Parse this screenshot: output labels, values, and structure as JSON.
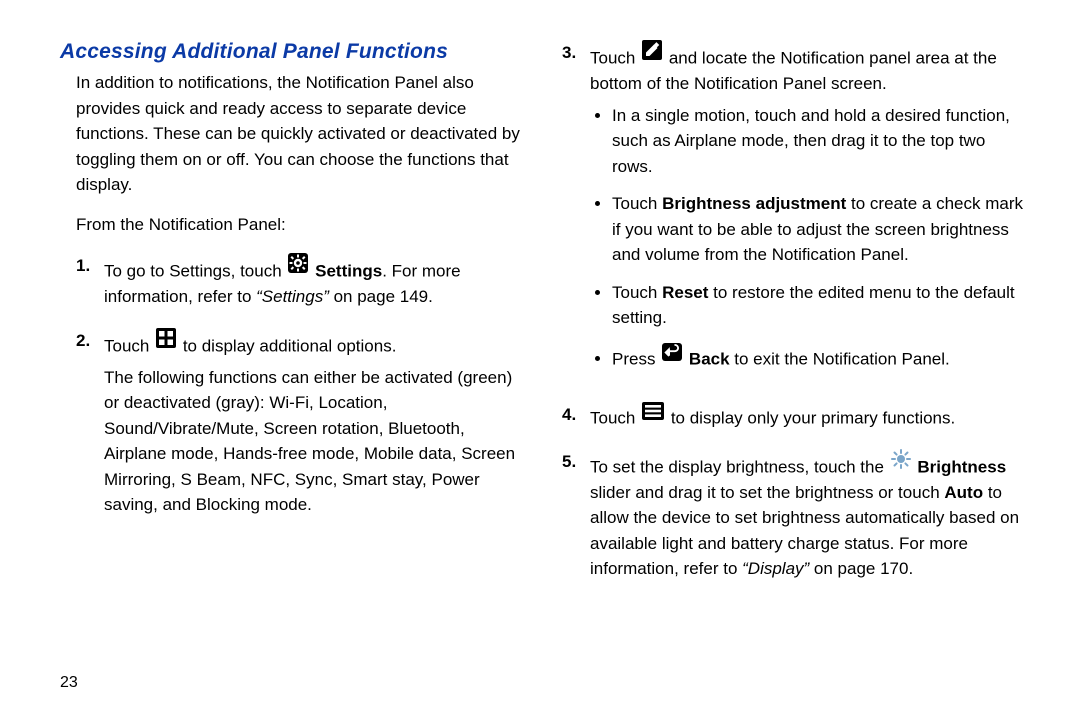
{
  "heading": "Accessing Additional Panel Functions",
  "intro": "In addition to notifications, the Notification Panel also provides quick and ready access to separate device functions. These can be quickly activated or deactivated by toggling them on or off. You can choose the functions that display.",
  "fromLine": "From the Notification Panel:",
  "step1": {
    "num": "1.",
    "t1": "To go to Settings, touch ",
    "iconLabel": "Settings",
    "t2": ". For more information, refer to ",
    "ref": "“Settings”",
    "t3": " on page 149."
  },
  "step2": {
    "num": "2.",
    "t1": "Touch ",
    "t2": " to display additional options.",
    "p2": "The following functions can either be activated (green) or deactivated (gray): Wi-Fi, Location, Sound/Vibrate/Mute, Screen rotation, Bluetooth, Airplane mode, Hands-free mode, Mobile data, Screen Mirroring, S Beam, NFC, Sync, Smart stay, Power saving, and Blocking mode."
  },
  "step3": {
    "num": "3.",
    "t1": "Touch ",
    "t2": " and locate the Notification panel area at the bottom of the Notification Panel screen.",
    "b1": "In a single motion, touch and hold a desired function, such as Airplane mode, then drag it to the top two rows.",
    "b2a": "Touch ",
    "b2bold": "Brightness adjustment",
    "b2b": " to create a check mark if you want to be able to adjust the screen brightness and volume from the Notification Panel.",
    "b3a": "Touch ",
    "b3bold": "Reset",
    "b3b": " to restore the edited menu to the default setting.",
    "b4a": "Press ",
    "b4bold": " Back",
    "b4b": " to exit the Notification Panel."
  },
  "step4": {
    "num": "4.",
    "t1": "Touch ",
    "t2": " to display only your primary functions."
  },
  "step5": {
    "num": "5.",
    "t1": "To set the display brightness, touch the ",
    "bold1": " Brightness",
    "t2": " slider and drag it to set the brightness or touch ",
    "bold2": "Auto",
    "t3": " to allow the device to set brightness automatically based on available light and battery charge status. For more information, refer to ",
    "ref": "“Display”",
    "t4": " on page 170."
  },
  "pageNumber": "23"
}
